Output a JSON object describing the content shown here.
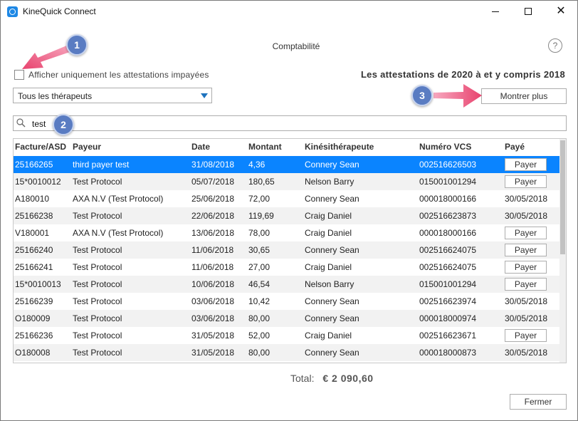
{
  "window": {
    "title": "KineQuick Connect",
    "controls": {
      "minimize": "—",
      "maximize": "☐",
      "close": "✕"
    }
  },
  "page": {
    "title": "Comptabilité",
    "help_label": "?"
  },
  "filters": {
    "unpaid_only_label": "Afficher uniquement les attestations impayées",
    "unpaid_only_checked": false,
    "therapist_select": "Tous les thérapeuts",
    "period_heading": "Les attestations de 2020 à et y compris 2018",
    "show_more_label": "Montrer plus",
    "search_value": "test"
  },
  "callouts": [
    "1",
    "2",
    "3"
  ],
  "table": {
    "columns": [
      "Facture/ASD",
      "Payeur",
      "Date",
      "Montant",
      "Kinésithérapeute",
      "Numéro VCS",
      "Payé"
    ],
    "pay_button_label": "Payer",
    "rows": [
      {
        "invoice": "25166265",
        "payer": "third payer test",
        "date": "31/08/2018",
        "amount": "4,36",
        "therapist": "Connery Sean",
        "vcs": "002516626503",
        "paid": "",
        "selected": true
      },
      {
        "invoice": "15*0010012",
        "payer": "Test Protocol",
        "date": "05/07/2018",
        "amount": "180,65",
        "therapist": "Nelson Barry",
        "vcs": "015001001294",
        "paid": ""
      },
      {
        "invoice": "A180010",
        "payer": "AXA N.V (Test Protocol)",
        "date": "25/06/2018",
        "amount": "72,00",
        "therapist": "Connery Sean",
        "vcs": "000018000166",
        "paid": "30/05/2018"
      },
      {
        "invoice": "25166238",
        "payer": "Test Protocol",
        "date": "22/06/2018",
        "amount": "119,69",
        "therapist": "Craig Daniel",
        "vcs": "002516623873",
        "paid": "30/05/2018"
      },
      {
        "invoice": "V180001",
        "payer": "AXA N.V (Test Protocol)",
        "date": "13/06/2018",
        "amount": "78,00",
        "therapist": "Craig Daniel",
        "vcs": "000018000166",
        "paid": ""
      },
      {
        "invoice": "25166240",
        "payer": "Test Protocol",
        "date": "11/06/2018",
        "amount": "30,65",
        "therapist": "Connery Sean",
        "vcs": "002516624075",
        "paid": ""
      },
      {
        "invoice": "25166241",
        "payer": "Test Protocol",
        "date": "11/06/2018",
        "amount": "27,00",
        "therapist": "Craig Daniel",
        "vcs": "002516624075",
        "paid": ""
      },
      {
        "invoice": "15*0010013",
        "payer": "Test Protocol",
        "date": "10/06/2018",
        "amount": "46,54",
        "therapist": "Nelson Barry",
        "vcs": "015001001294",
        "paid": ""
      },
      {
        "invoice": "25166239",
        "payer": "Test Protocol",
        "date": "03/06/2018",
        "amount": "10,42",
        "therapist": "Connery Sean",
        "vcs": "002516623974",
        "paid": "30/05/2018"
      },
      {
        "invoice": "O180009",
        "payer": "Test Protocol",
        "date": "03/06/2018",
        "amount": "80,00",
        "therapist": "Connery Sean",
        "vcs": "000018000974",
        "paid": "30/05/2018"
      },
      {
        "invoice": "25166236",
        "payer": "Test Protocol",
        "date": "31/05/2018",
        "amount": "52,00",
        "therapist": "Craig Daniel",
        "vcs": "002516623671",
        "paid": ""
      },
      {
        "invoice": "O180008",
        "payer": "Test Protocol",
        "date": "31/05/2018",
        "amount": "80,00",
        "therapist": "Connery Sean",
        "vcs": "000018000873",
        "paid": "30/05/2018"
      }
    ]
  },
  "footer": {
    "total_label": "Total:",
    "total_value": "€ 2 090,60",
    "close_label": "Fermer"
  },
  "colors": {
    "selection": "#0a84ff",
    "callout": "#5a7cc2",
    "arrow": "#e8436e",
    "accent": "#1e73be"
  }
}
